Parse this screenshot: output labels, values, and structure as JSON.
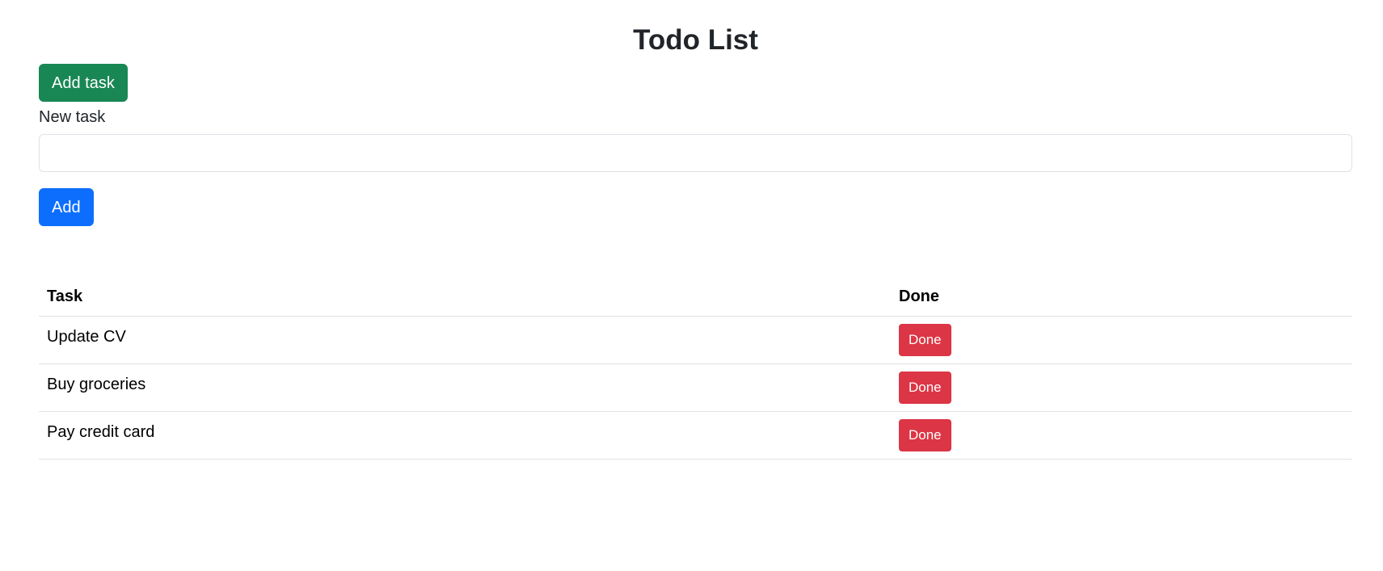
{
  "header": {
    "title": "Todo List"
  },
  "toolbar": {
    "add_task_label": "Add task"
  },
  "form": {
    "label": "New task",
    "value": "",
    "placeholder": "",
    "add_label": "Add"
  },
  "table": {
    "columns": [
      "Task",
      "Done"
    ],
    "rows": [
      {
        "task": "Update CV",
        "action": "Done"
      },
      {
        "task": "Buy groceries",
        "action": "Done"
      },
      {
        "task": "Pay credit card",
        "action": "Done"
      }
    ]
  },
  "colors": {
    "success": "#198754",
    "primary": "#0d6efd",
    "danger": "#dc3545"
  }
}
